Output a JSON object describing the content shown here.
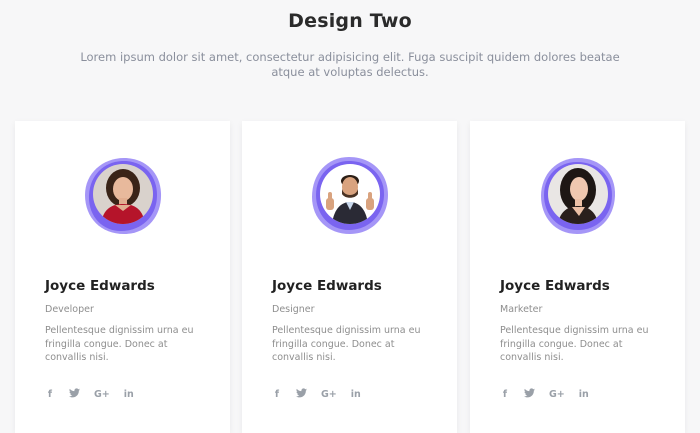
{
  "section": {
    "title": "Design Two",
    "subtitle": "Lorem ipsum dolor sit amet, consectetur adipisicing elit. Fuga suscipit quidem dolores beatae atque at voluptas delectus."
  },
  "colors": {
    "accent": "#7a64f0",
    "accent_light": "#a596f7"
  },
  "cards": [
    {
      "name": "Joyce Edwards",
      "role": "Developer",
      "description": "Pellentesque dignissim urna eu fringilla congue. Donec at convallis nisi.",
      "avatar_icon": "woman-red-top-photo",
      "social": [
        "f",
        "🐦",
        "G+",
        "in"
      ]
    },
    {
      "name": "Joyce Edwards",
      "role": "Designer",
      "description": "Pellentesque dignissim urna eu fringilla congue. Donec at convallis nisi.",
      "avatar_icon": "man-thumbs-up-photo",
      "social": [
        "f",
        "🐦",
        "G+",
        "in"
      ]
    },
    {
      "name": "Joyce Edwards",
      "role": "Marketer",
      "description": "Pellentesque dignissim urna eu fringilla congue. Donec at convallis nisi.",
      "avatar_icon": "woman-dark-hair-photo",
      "social": [
        "f",
        "🐦",
        "G+",
        "in"
      ]
    }
  ]
}
